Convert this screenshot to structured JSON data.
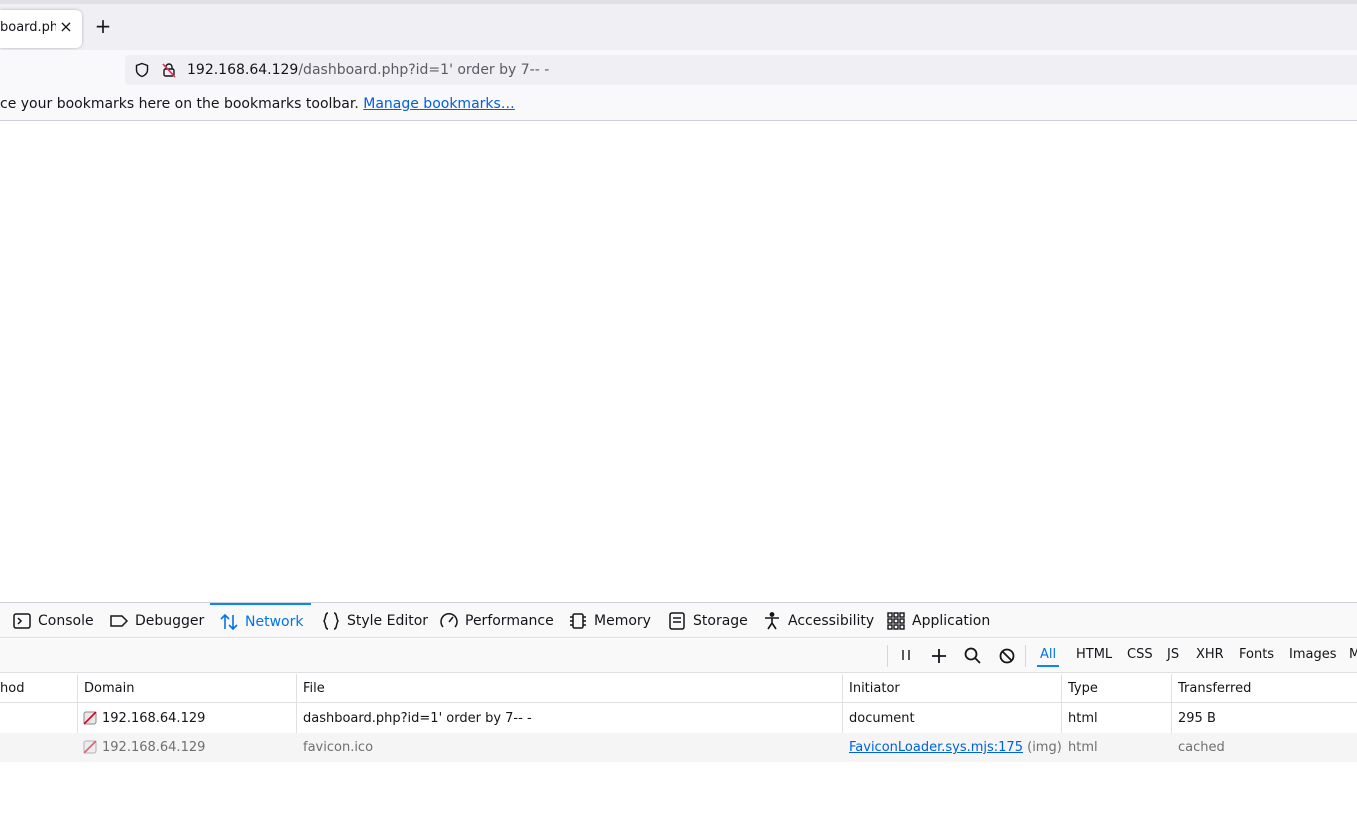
{
  "browser": {
    "tab": {
      "title": "board.ph",
      "close_glyph": "×"
    },
    "new_tab_glyph": "+",
    "url": {
      "host": "192.168.64.129",
      "path": "/dashboard.php?id=1' order by 7-- -"
    },
    "bookmarks_bar": {
      "message": "ce your bookmarks here on the bookmarks toolbar. ",
      "manage_link": "Manage bookmarks…"
    }
  },
  "devtools": {
    "tabs": [
      {
        "label": "Console",
        "icon": "console-icon"
      },
      {
        "label": "Debugger",
        "icon": "debugger-icon"
      },
      {
        "label": "Network",
        "icon": "network-icon",
        "active": true
      },
      {
        "label": "Style Editor",
        "icon": "style-editor-icon"
      },
      {
        "label": "Performance",
        "icon": "performance-icon"
      },
      {
        "label": "Memory",
        "icon": "memory-icon"
      },
      {
        "label": "Storage",
        "icon": "storage-icon"
      },
      {
        "label": "Accessibility",
        "icon": "accessibility-icon"
      },
      {
        "label": "Application",
        "icon": "application-icon"
      }
    ],
    "filters": [
      "All",
      "HTML",
      "CSS",
      "JS",
      "XHR",
      "Fonts",
      "Images",
      "M"
    ],
    "columns": [
      "hod",
      "Domain",
      "File",
      "Initiator",
      "Type",
      "Transferred"
    ],
    "requests": [
      {
        "domain": "192.168.64.129",
        "file": "dashboard.php?id=1' order by 7-- -",
        "initiator": "document",
        "initiator_suffix": "",
        "type": "html",
        "transferred": "295 B"
      },
      {
        "domain": "192.168.64.129",
        "file": "favicon.ico",
        "initiator": "FaviconLoader.sys.mjs:175",
        "initiator_suffix": " (img)",
        "type": "html",
        "transferred": "cached"
      }
    ]
  }
}
